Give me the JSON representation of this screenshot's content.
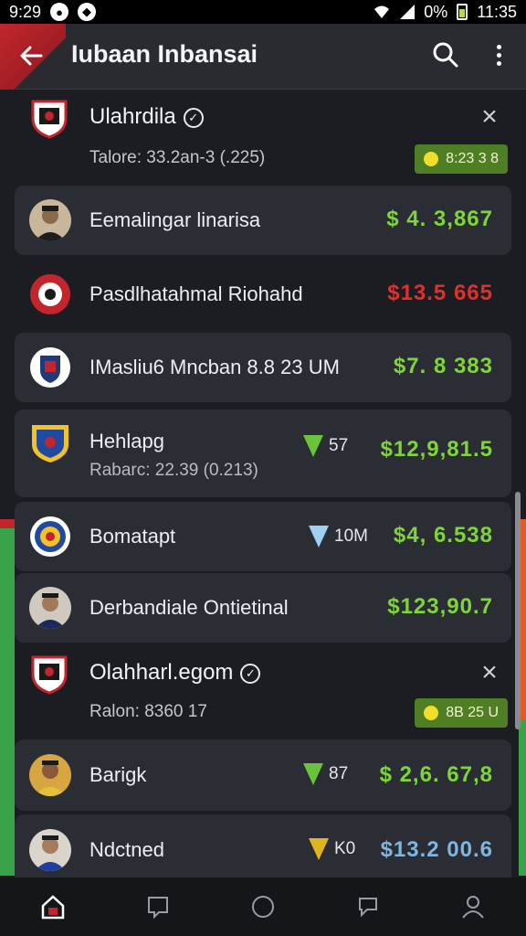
{
  "status": {
    "time_left": "9:29",
    "battery_pct": "0%",
    "time_right": "11:35"
  },
  "appbar": {
    "title": "Iubaan Inbansai"
  },
  "groups": [
    {
      "title": "Ulahrdila",
      "subtitle": "Talore: 33.2an-3 (.225)",
      "chip": "8:23 3 8",
      "rows": [
        {
          "name": "Eemalingar linarisa",
          "price": "$ 4. 3,867",
          "price_color": "#7fd43a"
        },
        {
          "name": "Pasdlhatahmal Riohahd",
          "price": "$13.5 665",
          "price_color": "#e0302e"
        },
        {
          "name": "IMasliu6 Mncban 8.8 23 UM",
          "price": "$7. 8 383",
          "price_color": "#7fd43a"
        },
        {
          "name": "Hehlapg",
          "meta": "Rabarc: 22.39 (0.213)",
          "trend": "57",
          "price": "$12,9,81.5",
          "price_color": "#7fd43a"
        },
        {
          "name": "Bomatapt",
          "trend": "10M",
          "price": "$4, 6.538",
          "price_color": "#7fd43a"
        },
        {
          "name": "Derbandiale Ontietinal",
          "price": "$123,90.7",
          "price_color": "#7fd43a"
        }
      ]
    },
    {
      "title": "Olahharl.egom",
      "subtitle": "Ralon: 8360 17",
      "chip": "8B 25 U",
      "rows": [
        {
          "name": "Barigk",
          "trend": "87",
          "price": "$ 2,6. 67,8",
          "price_color": "#7fd43a"
        },
        {
          "name": "Ndctned",
          "trend": "K0",
          "price": "$13.2 00.6",
          "price_color": "#7fb6e0"
        }
      ]
    }
  ],
  "nav": [
    "home-icon",
    "square-back-icon",
    "circle-home-icon",
    "chat-icon",
    "profile-icon"
  ]
}
